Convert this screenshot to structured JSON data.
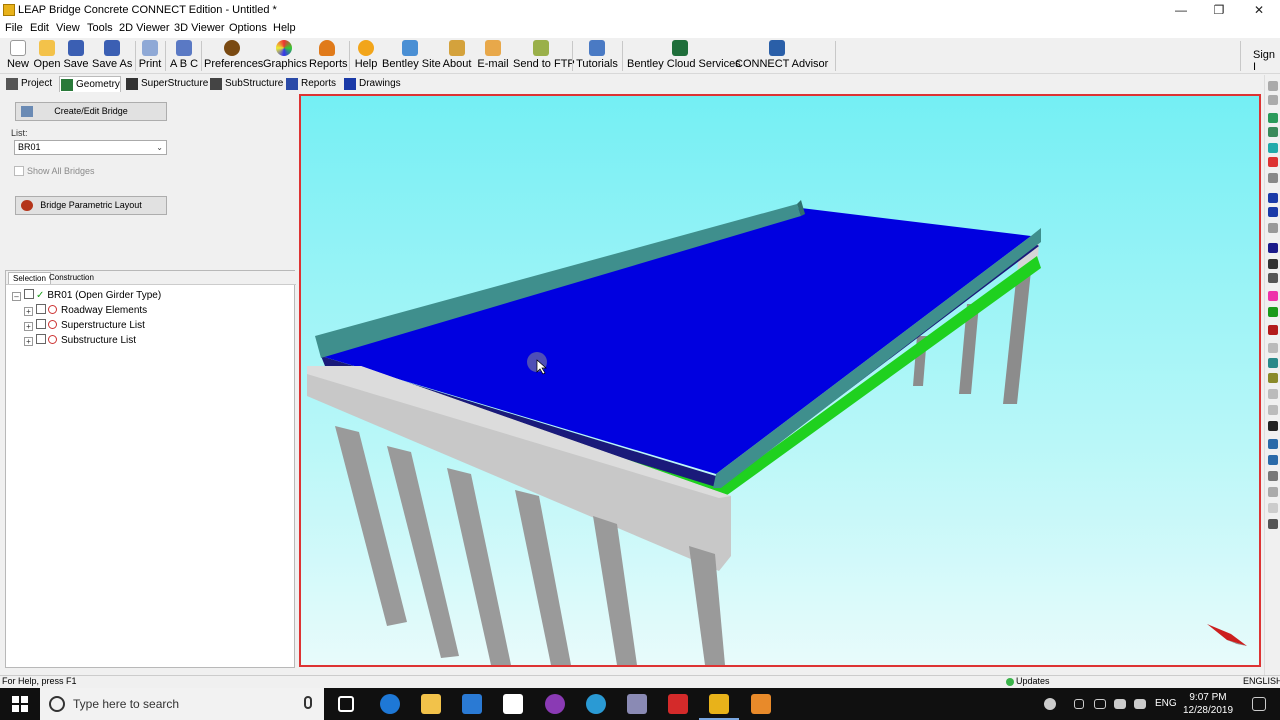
{
  "window": {
    "title": "LEAP Bridge Concrete CONNECT Edition - Untitled *",
    "minimize": "—",
    "restore": "❐",
    "close": "✕"
  },
  "menu": [
    "File",
    "Edit",
    "View",
    "Tools",
    "2D Viewer",
    "3D Viewer",
    "Options",
    "Help"
  ],
  "toolbar": {
    "new": "New",
    "open": "Open",
    "save": "Save",
    "save_as": "Save As",
    "print": "Print",
    "abc": "A B C",
    "preferences": "Preferences",
    "graphics": "Graphics",
    "reports": "Reports",
    "help": "Help",
    "bentley_site": "Bentley Site",
    "about": "About",
    "email": "E-mail",
    "send_ftp": "Send to FTP",
    "tutorials": "Tutorials",
    "bentley_cloud": "Bentley Cloud Services",
    "connect_advisor": "CONNECT Advisor",
    "sign_in": "Sign I"
  },
  "tabs": [
    "Project",
    "Geometry",
    "SuperStructure",
    "SubStructure",
    "Reports",
    "Drawings"
  ],
  "active_tab": "Geometry",
  "left": {
    "create_edit_bridge": "Create/Edit Bridge",
    "list_label": "List:",
    "list_value": "BR01",
    "show_all": "Show All Bridges",
    "parametric_layout": "Bridge Parametric Layout"
  },
  "tree": {
    "tabs": [
      "Selection",
      "Construction"
    ],
    "root": "BR01 (Open Girder Type)",
    "children": [
      "Roadway Elements",
      "Superstructure List",
      "Substructure List"
    ]
  },
  "status": {
    "help": "For Help, press F1",
    "updates": "Updates",
    "language": "ENGLISH"
  },
  "taskbar": {
    "search_placeholder": "Type here to search",
    "lang": "ENG",
    "time": "9:07 PM",
    "date": "12/28/2019"
  },
  "colors": {
    "deck": "#0000e0",
    "barrier": "#3a8a88",
    "girder": "#1fd11f",
    "cap": "#c8c8c8",
    "column": "#9a9a9a",
    "viewport_border": "#dd3333"
  }
}
